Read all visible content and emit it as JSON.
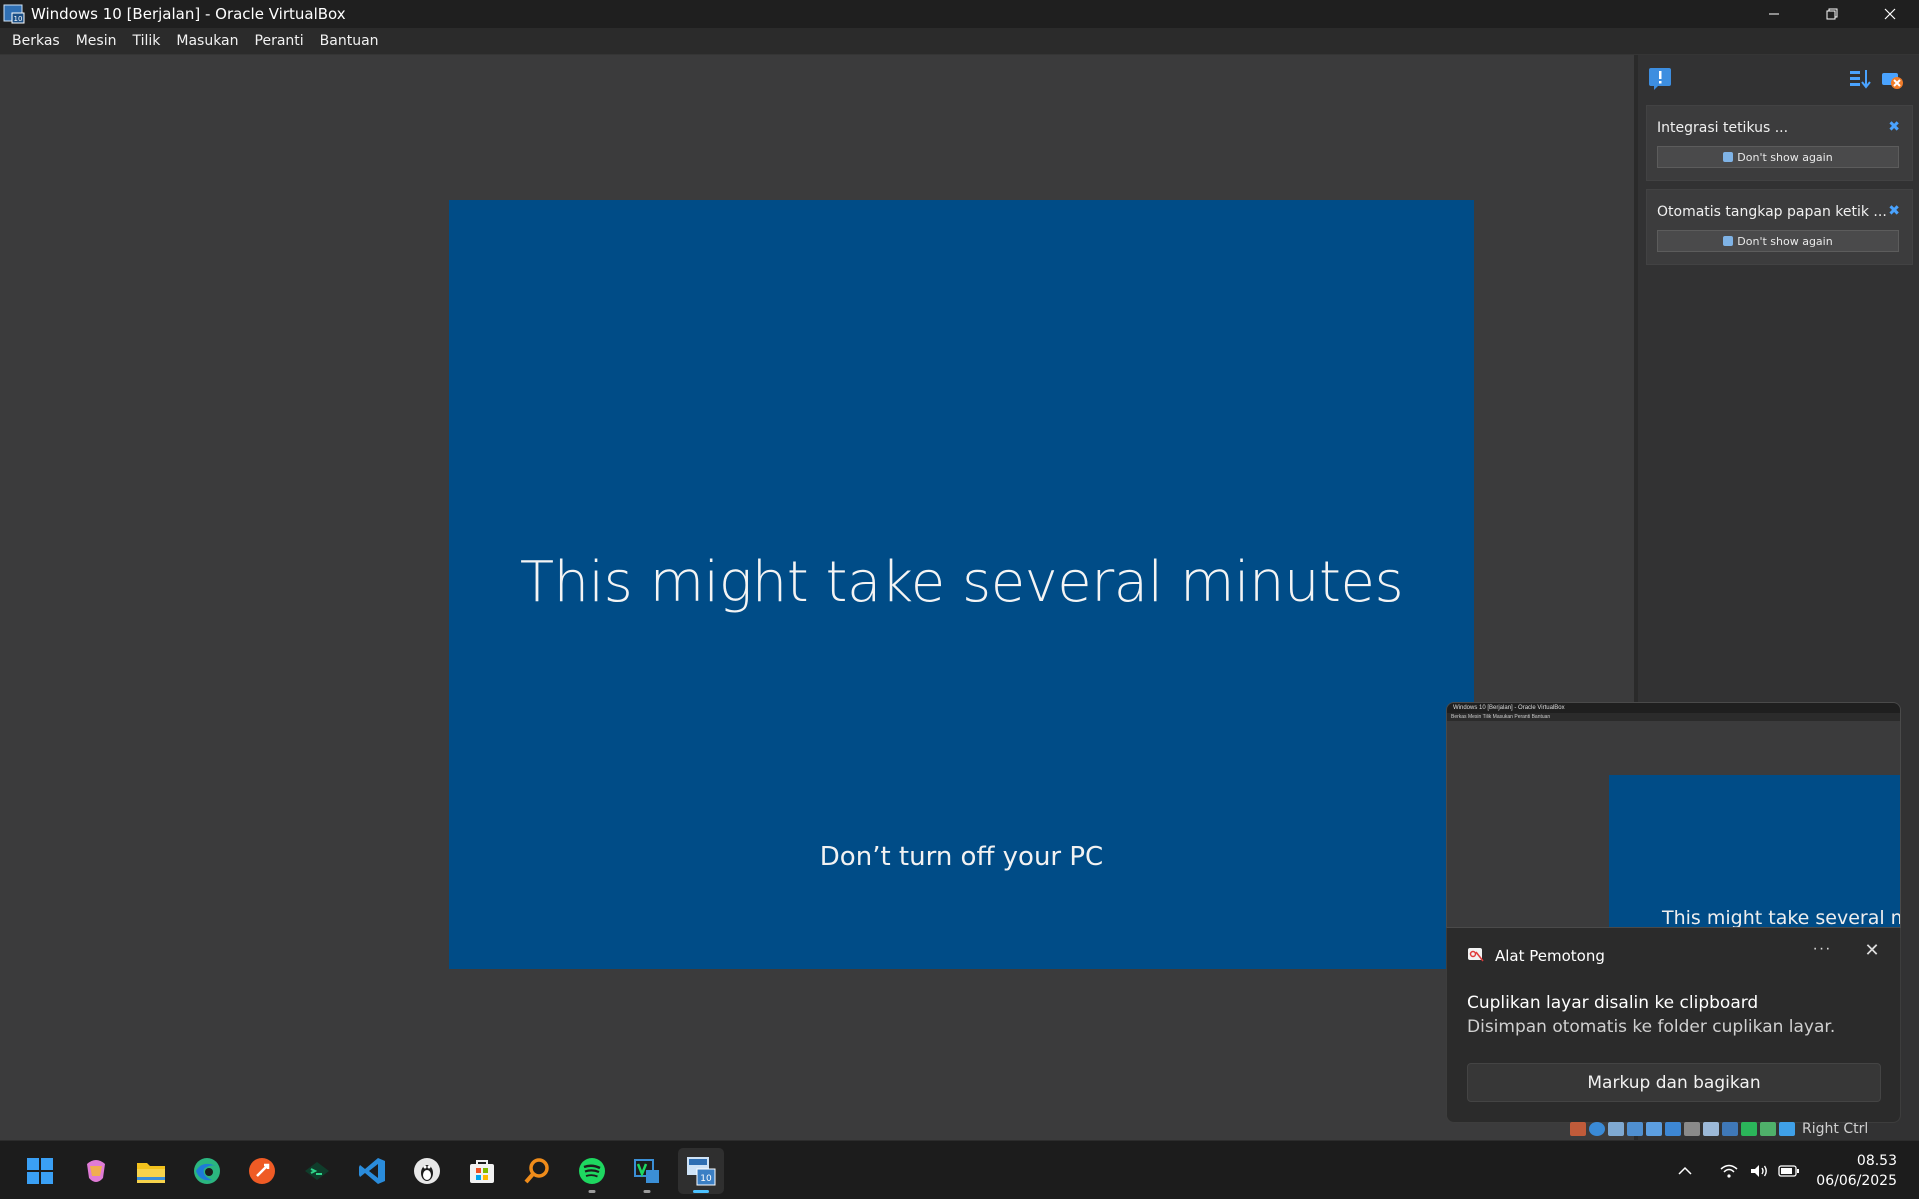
{
  "window": {
    "title": "Windows 10 [Berjalan] - Oracle VirtualBox",
    "controls": {
      "minimize": "—",
      "restore": "❐",
      "close": "✕"
    }
  },
  "menubar": {
    "items": [
      "Berkas",
      "Mesin",
      "Tilik",
      "Masukan",
      "Peranti",
      "Bantuan"
    ]
  },
  "vm": {
    "main_message": "This might take several minutes",
    "sub_message": "Don’t turn off your PC",
    "screen_color": "#004c87"
  },
  "notification_panel": {
    "icons": [
      "notification-center-icon",
      "sort-icon",
      "dismiss-all-icon"
    ],
    "cards": [
      {
        "title": "Integrasi tetikus ...",
        "button_label": "Don't show again"
      },
      {
        "title": "Otomatis tangkap papan ketik ...",
        "button_label": "Don't show again"
      }
    ]
  },
  "snip_preview": {
    "title": "Windows 10 [Berjalan] - Oracle VirtualBox",
    "menu": "Berkas  Mesin  Tilik  Masukan  Peranti  Bantuan",
    "text": "This might take several minu"
  },
  "toast": {
    "app_name": "Alat Pemotong",
    "more": "···",
    "close": "✕",
    "heading": "Cuplikan layar disalin ke clipboard",
    "body": "Disimpan otomatis ke folder cuplikan layar.",
    "action_label": "Markup dan bagikan"
  },
  "vbox_status": {
    "host_key": "Right Ctrl"
  },
  "taskbar": {
    "apps": [
      {
        "name": "start-icon",
        "color": "#3aa0f5"
      },
      {
        "name": "copilot-icon",
        "color": "#e07bd6"
      },
      {
        "name": "file-explorer-icon",
        "color": "#f3c21c"
      },
      {
        "name": "edge-icon",
        "color": "#2bb57f"
      },
      {
        "name": "postman-icon",
        "color": "#ef5b25"
      },
      {
        "name": "terminal-icon",
        "color": "#1ea070"
      },
      {
        "name": "vscode-icon",
        "color": "#2a8cdb"
      },
      {
        "name": "penguin-app-icon",
        "color": "#e8e8e8"
      },
      {
        "name": "store-icon",
        "color": "#f2f2f2"
      },
      {
        "name": "search-app-icon",
        "color": "#f08c1a"
      },
      {
        "name": "spotify-icon",
        "color": "#1ed760"
      },
      {
        "name": "virtualbox-manager-icon",
        "color": "#3b8fd6"
      },
      {
        "name": "virtualbox-vm-icon",
        "color": "#9fc8ef"
      }
    ],
    "tray": {
      "chevron": "^",
      "wifi": "wifi",
      "volume": "volume",
      "battery": "battery"
    },
    "time": "08.53",
    "date": "06/06/2025"
  }
}
